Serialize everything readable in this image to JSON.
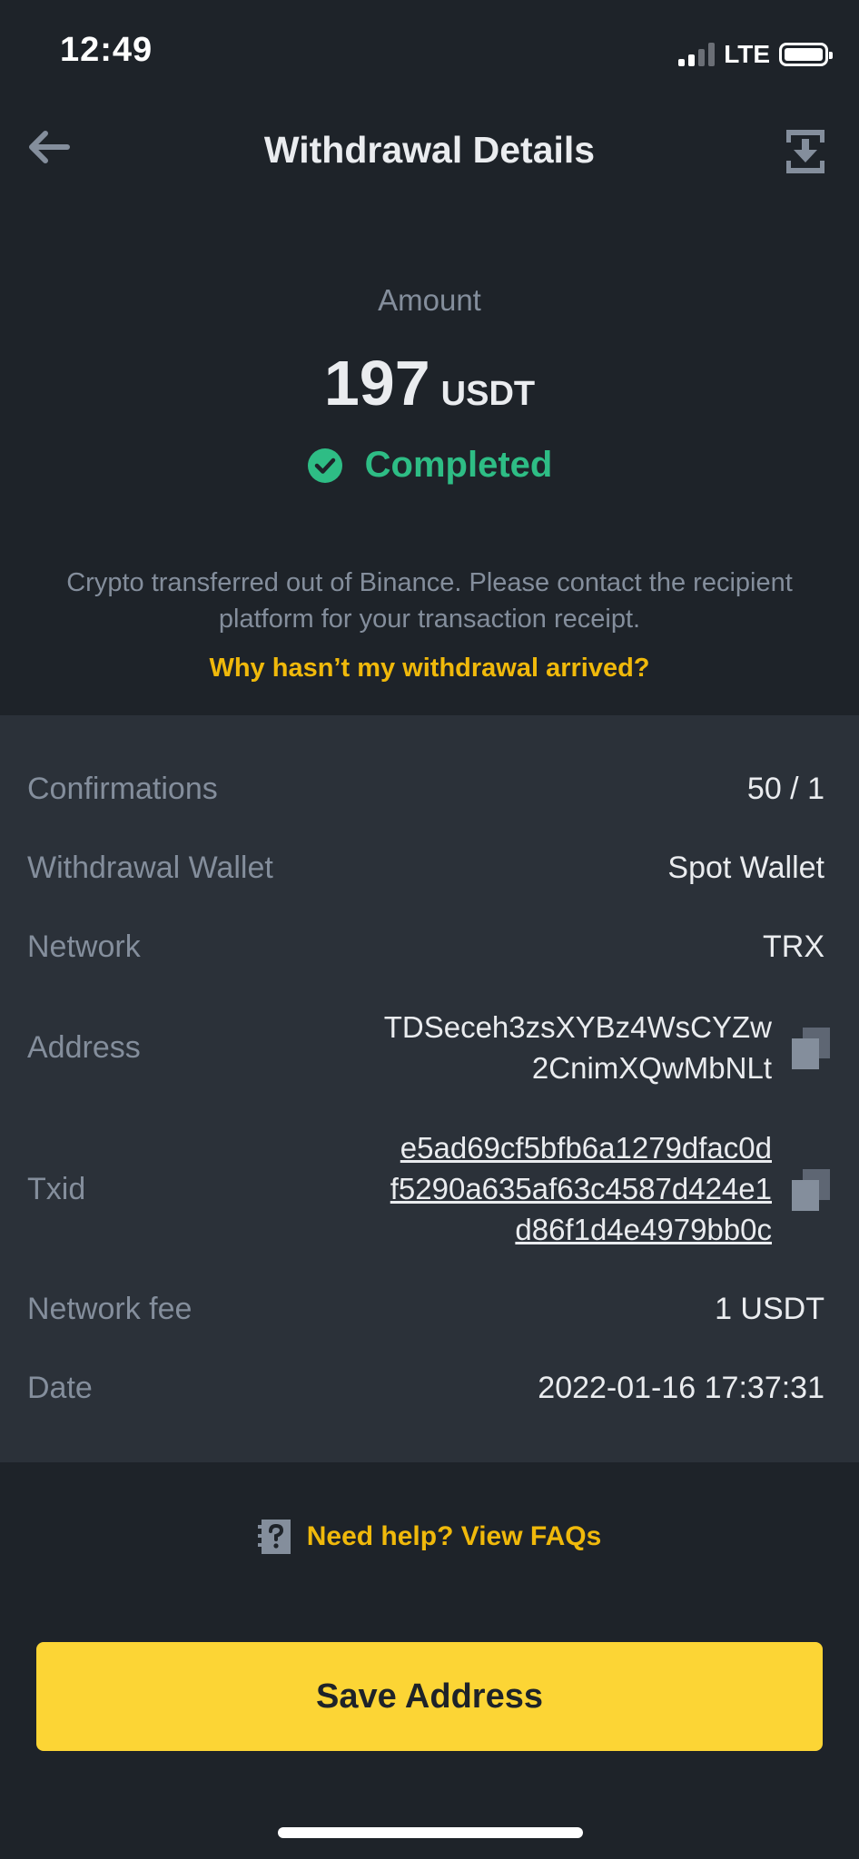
{
  "status_bar": {
    "time": "12:49",
    "network": "LTE"
  },
  "header": {
    "title": "Withdrawal Details",
    "back_icon": "back-arrow-icon",
    "action_icon": "download-icon"
  },
  "summary": {
    "amount_label": "Amount",
    "amount": "197",
    "unit": "USDT",
    "status": "Completed",
    "status_color": "#2ebd85",
    "notice": "Crypto transferred out of Binance. Please contact the recipient platform for your transaction receipt.",
    "help_link": "Why hasn’t my withdrawal arrived?"
  },
  "details": {
    "confirmations": {
      "label": "Confirmations",
      "value": "50 / 1"
    },
    "wallet": {
      "label": "Withdrawal Wallet",
      "value": "Spot Wallet"
    },
    "network": {
      "label": "Network",
      "value": "TRX"
    },
    "address": {
      "label": "Address",
      "line1": "TDSeceh3zsXYBz4WsCYZw",
      "line2": "2CnimXQwMbNLt"
    },
    "txid": {
      "label": "Txid",
      "line1": "e5ad69cf5bfb6a1279dfac0d",
      "line2": "f5290a635af63c4587d424e1",
      "line3": "d86f1d4e4979bb0c"
    },
    "fee": {
      "label": "Network fee",
      "value": "1 USDT"
    },
    "date": {
      "label": "Date",
      "value": "2022-01-16 17:37:31"
    }
  },
  "footer": {
    "faq": "Need help? View FAQs",
    "save_button": "Save Address",
    "accent_color": "#fcd535"
  }
}
